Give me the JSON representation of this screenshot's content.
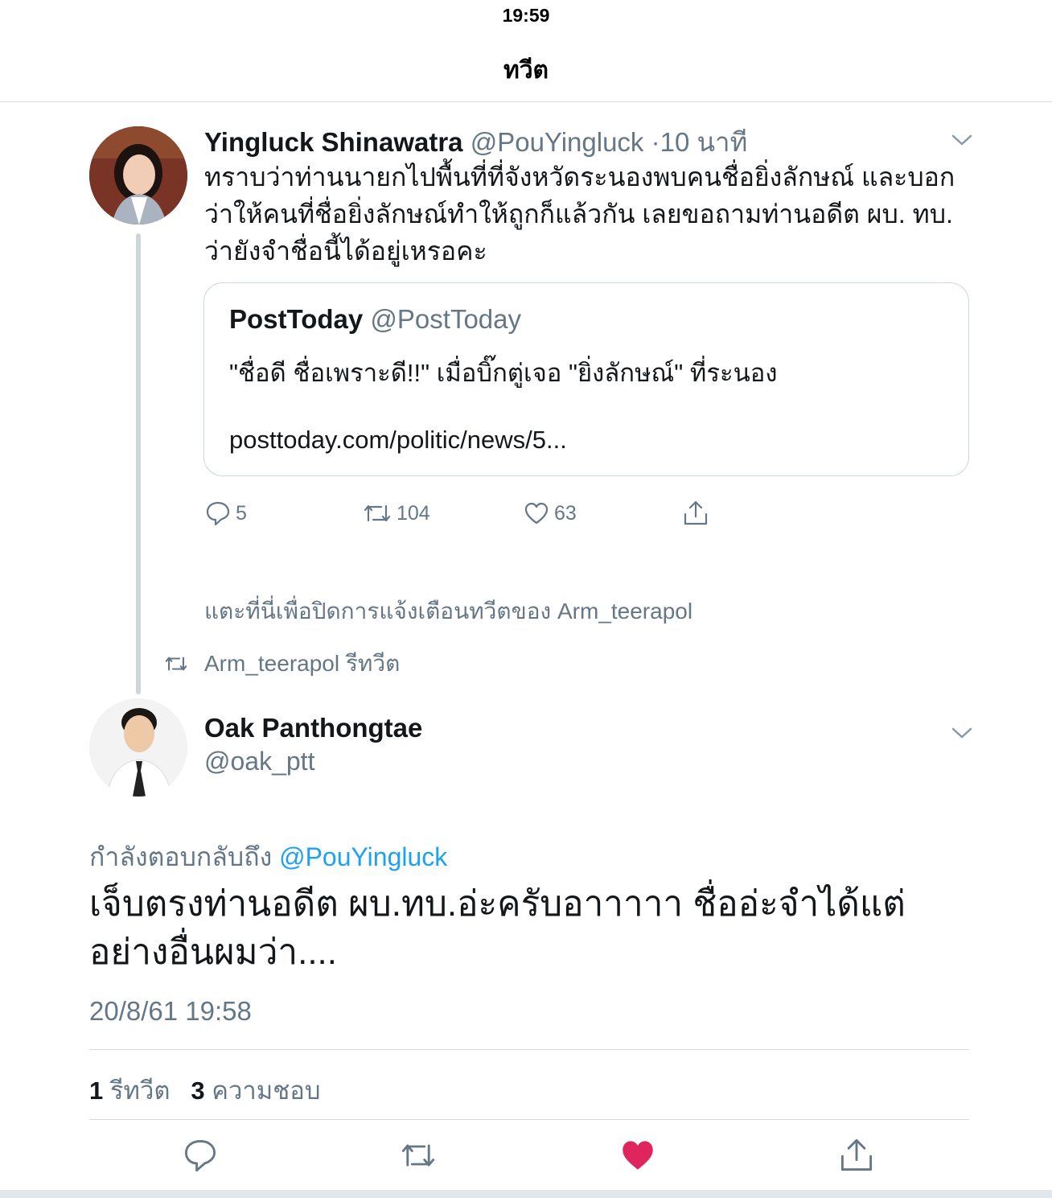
{
  "status_bar": {
    "time": "19:59"
  },
  "nav": {
    "title": "ทวีต"
  },
  "parent_tweet": {
    "name": "Yingluck Shinawatra",
    "handle": "@PouYingluck",
    "separator": "·",
    "time": "10 นาที",
    "text": "ทราบว่าท่านนายกไปพื้นที่ที่จังหวัดระนองพบคนชื่อยิ่งลักษณ์ และบอกว่าให้คนที่ชื่อยิ่งลักษณ์ทำให้ถูกก็แล้วกัน เลยขอถามท่านอดีต ผบ. ทบ. ว่ายังจำชื่อนี้ได้อยู่เหรอคะ",
    "quote": {
      "name": "PostToday",
      "handle": "@PostToday",
      "text": "\"ชื่อดี ชื่อเพราะดี!!\" เมื่อบิ๊กตู่เจอ \"ยิ่งลักษณ์\" ที่ระนอง",
      "link": "posttoday.com/politic/news/5..."
    },
    "actions": {
      "replies": "5",
      "retweets": "104",
      "likes": "63"
    }
  },
  "mute_notice": "แตะที่นี่เพื่อปิดการแจ้งเตือนทวีตของ Arm_teerapol",
  "retweet_notice": "Arm_teerapol รีทวีต",
  "main_tweet": {
    "name": "Oak Panthongtae",
    "handle": "@oak_ptt",
    "reply_prefix": "กำลังตอบกลับถึง",
    "reply_mention": "@PouYingluck",
    "text": "เจ็บตรงท่านอดีต ผบ.ทบ.อ่ะครับอาาาาา ชื่ออ่ะจำได้แต่อย่างอื่นผมว่า....",
    "timestamp": "20/8/61 19:58",
    "retweet_count": "1",
    "retweet_label": "รีทวีต",
    "like_count": "3",
    "like_label": "ความชอบ"
  },
  "colors": {
    "link_blue": "#1da1f2",
    "secondary_gray": "#657786",
    "like_red": "#e0245e",
    "divider": "#d4d9dd"
  },
  "icons": [
    "chevron-down-icon",
    "reply-icon",
    "retweet-icon",
    "like-icon",
    "share-icon"
  ]
}
